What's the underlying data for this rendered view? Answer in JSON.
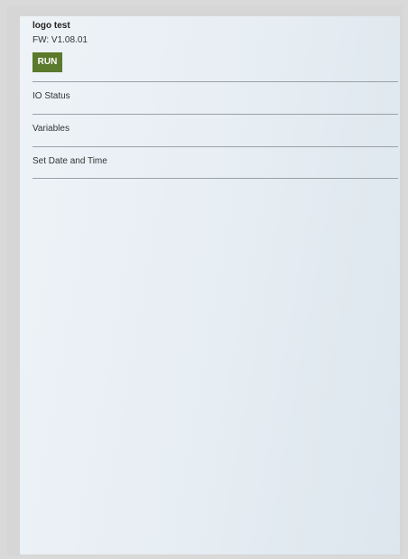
{
  "device": {
    "name": "logo test",
    "firmware": "FW: V1.08.01"
  },
  "run_button": {
    "label": "RUN",
    "color": "#5b7a2c"
  },
  "menu": {
    "items": [
      {
        "label": "IO Status"
      },
      {
        "label": "Variables"
      },
      {
        "label": "Set Date and Time"
      }
    ]
  }
}
